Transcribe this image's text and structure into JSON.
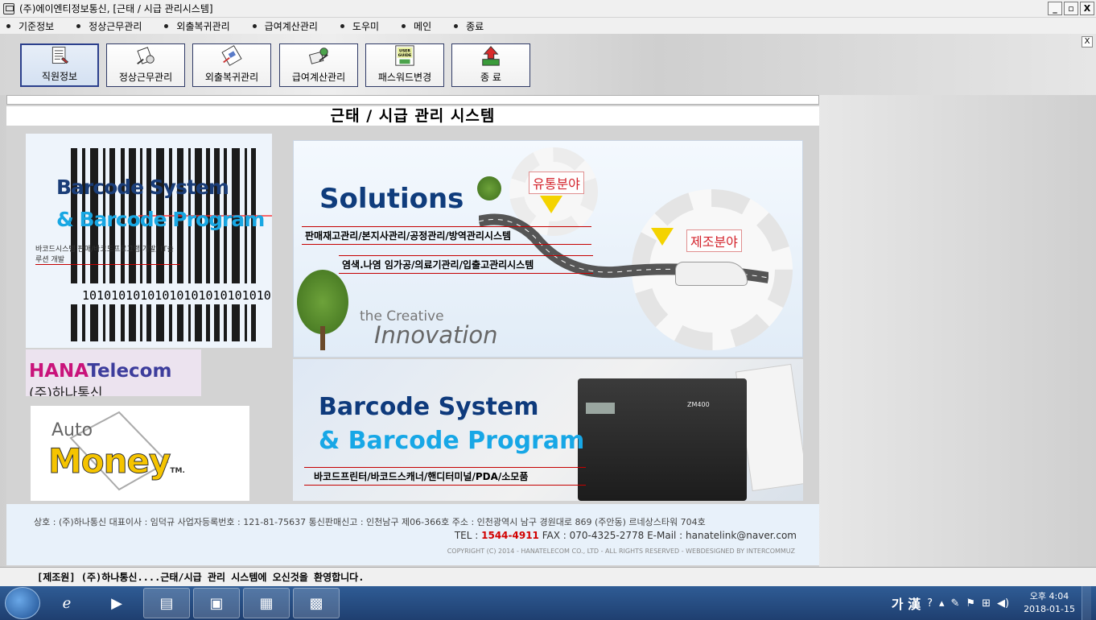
{
  "window": {
    "title": "(주)에이엔티정보통신, [근태 / 시급 관리시스템]",
    "minimize": "_",
    "restore": "▫",
    "close": "X"
  },
  "menu": [
    {
      "label": "기준정보"
    },
    {
      "label": "정상근무관리"
    },
    {
      "label": "외출복귀관리"
    },
    {
      "label": "급여계산관리"
    },
    {
      "label": "도우미"
    },
    {
      "label": "메인"
    },
    {
      "label": "종료"
    }
  ],
  "toolbar": [
    {
      "label": "직원정보",
      "icon": "employee-info-icon",
      "active": true
    },
    {
      "label": "정상근무관리",
      "icon": "normal-work-icon"
    },
    {
      "label": "외출복귀관리",
      "icon": "outing-return-icon"
    },
    {
      "label": "급여계산관리",
      "icon": "payroll-icon"
    },
    {
      "label": "패스워드변경",
      "icon": "user-guide-icon",
      "icon_text": "USER GUIDE"
    },
    {
      "label": "종   료",
      "icon": "exit-icon"
    }
  ],
  "main": {
    "title": "근태 / 시급 관리 시스템"
  },
  "banners": {
    "barcode_left": {
      "line1": "Barcode System",
      "line2": "& Barcode Program",
      "sub": "바코드시스템 판매/바코드프로그램 개발/ IT솔루션 개발",
      "digits": "101010101010101010101010101"
    },
    "hana": {
      "hana": "HANA",
      "telecom": "Telecom",
      "korean": "(주)하나통신"
    },
    "automoney": {
      "auto": "Auto",
      "money": "Money",
      "tm": "TM."
    },
    "solutions": {
      "title": "Solutions",
      "line1": "판매재고관리/본지사관리/공정관리/방역관리시스템",
      "line2": "염색.나염 임가공/의료기관리/입출고관리시스템",
      "area1": "유통분야",
      "area2": "제조분야",
      "creative1": "the Creative",
      "creative2": "Innovation"
    },
    "barcode_right": {
      "line1": "Barcode System",
      "line2": "& Barcode Program",
      "sub": "바코드프린터/바코드스캐너/핸디터미널/PDA/소모품",
      "printer_brand": "ZM400"
    }
  },
  "footer": {
    "line1": "상호 : (주)하나통신   대표이사 : 임덕규   사업자등록번호 : 121-81-75637   통신판매신고 : 인천남구 제06-366호   주소 : 인천광역시 남구 경원대로 869 (주안동) 르네상스타워 704호",
    "tel_label": "TEL : ",
    "tel": "1544-4911",
    "fax": "   FAX : 070-4325-2778   E-Mail : hanatelink@naver.com",
    "copyright": "COPYRIGHT (C) 2014 - HANATELECOM CO., LTD -  ALL RIGHTS RESERVED - WEBDESIGNED BY INTERCOMMUZ"
  },
  "status": {
    "text": "[제조원] (주)하나통신....근태/시급 관리 시스템에 오신것을 환영합니다."
  },
  "taskbar": {
    "lang": "가 漢",
    "time": "오후 4:04",
    "date": "2018-01-15"
  },
  "colors": {
    "accent": "#2b3f8c",
    "tel_red": "#d20000",
    "taskbar": "#2f5c95"
  }
}
